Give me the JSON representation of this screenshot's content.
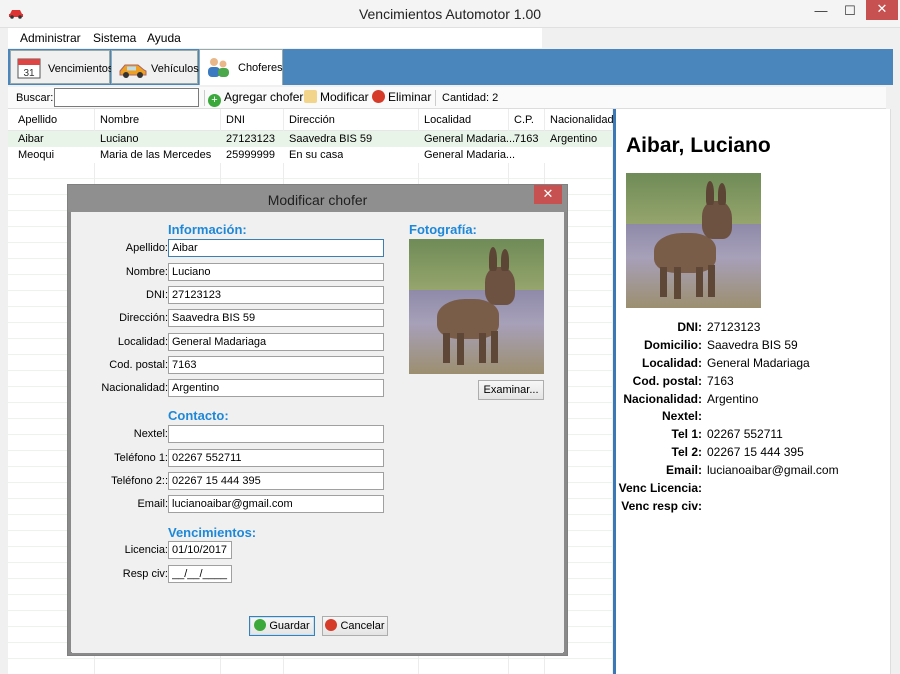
{
  "window": {
    "title": "Vencimientos Automotor 1.00",
    "min_glyph": "—",
    "max_glyph": "☐",
    "close_glyph": "✕"
  },
  "menu": [
    "Administrar",
    "Sistema",
    "Ayuda"
  ],
  "tabs": [
    {
      "label": "Vencimientos",
      "icon": "calendar-icon",
      "icon_text": "31"
    },
    {
      "label": "Vehículos",
      "icon": "car-icon"
    },
    {
      "label": "Choferes",
      "icon": "people-icon"
    }
  ],
  "toolbar": {
    "search_label": "Buscar:",
    "search_value": "",
    "add_label": "Agregar chofer",
    "edit_label": "Modificar",
    "delete_label": "Eliminar",
    "count_text": "Cantidad: 2"
  },
  "grid": {
    "columns": [
      "Apellido",
      "Nombre",
      "DNI",
      "Dirección",
      "Localidad",
      "C.P.",
      "Nacionalidad"
    ],
    "rows": [
      [
        "Aibar",
        "Luciano",
        "27123123",
        "Saavedra BIS 59",
        "General Madaria...",
        "7163",
        "Argentino"
      ],
      [
        "Meoqui",
        "Maria de las Mercedes",
        "25999999",
        "En su casa",
        "General Madaria...",
        "",
        ""
      ]
    ]
  },
  "details": {
    "name": "Aibar, Luciano",
    "fields": [
      {
        "label": "DNI:",
        "value": "27123123"
      },
      {
        "label": "Domicilio:",
        "value": "Saavedra BIS 59"
      },
      {
        "label": "Localidad:",
        "value": "General Madariaga"
      },
      {
        "label": "Cod. postal:",
        "value": "7163"
      },
      {
        "label": "Nacionalidad:",
        "value": "Argentino"
      },
      {
        "label": "Nextel:",
        "value": ""
      },
      {
        "label": "Tel 1:",
        "value": "02267 552711"
      },
      {
        "label": "Tel 2:",
        "value": "02267 15 444 395"
      },
      {
        "label": "Email:",
        "value": "lucianoaibar@gmail.com"
      },
      {
        "label": "Venc Licencia:",
        "value": ""
      },
      {
        "label": "Venc resp civ:",
        "value": ""
      }
    ]
  },
  "dialog": {
    "title": "Modificar chofer",
    "close_glyph": "✕",
    "section_info": "Información:",
    "section_contact": "Contacto:",
    "section_venc": "Vencimientos:",
    "section_photo": "Fotografía:",
    "info_fields": [
      {
        "label": "Apellido:",
        "value": "Aibar"
      },
      {
        "label": "Nombre:",
        "value": "Luciano"
      },
      {
        "label": "DNI:",
        "value": "27123123"
      },
      {
        "label": "Dirección:",
        "value": "Saavedra BIS 59"
      },
      {
        "label": "Localidad:",
        "value": "General Madariaga"
      },
      {
        "label": "Cod. postal:",
        "value": "7163"
      },
      {
        "label": "Nacionalidad:",
        "value": "Argentino"
      }
    ],
    "contact_fields": [
      {
        "label": "Nextel:",
        "value": ""
      },
      {
        "label": "Teléfono 1:",
        "value": "02267 552711"
      },
      {
        "label": "Teléfono 2::",
        "value": "02267 15 444 395"
      },
      {
        "label": "Email:",
        "value": "lucianoaibar@gmail.com"
      }
    ],
    "venc_fields": [
      {
        "label": "Licencia:",
        "value": "01/10/2017"
      },
      {
        "label": "Resp civ:",
        "value": "__/__/____"
      }
    ],
    "browse_label": "Examinar...",
    "save_label": "Guardar",
    "cancel_label": "Cancelar"
  },
  "colors": {
    "accent": "#4a86bc",
    "section": "#1e88d8",
    "row_selected": "#e9f4e9"
  }
}
